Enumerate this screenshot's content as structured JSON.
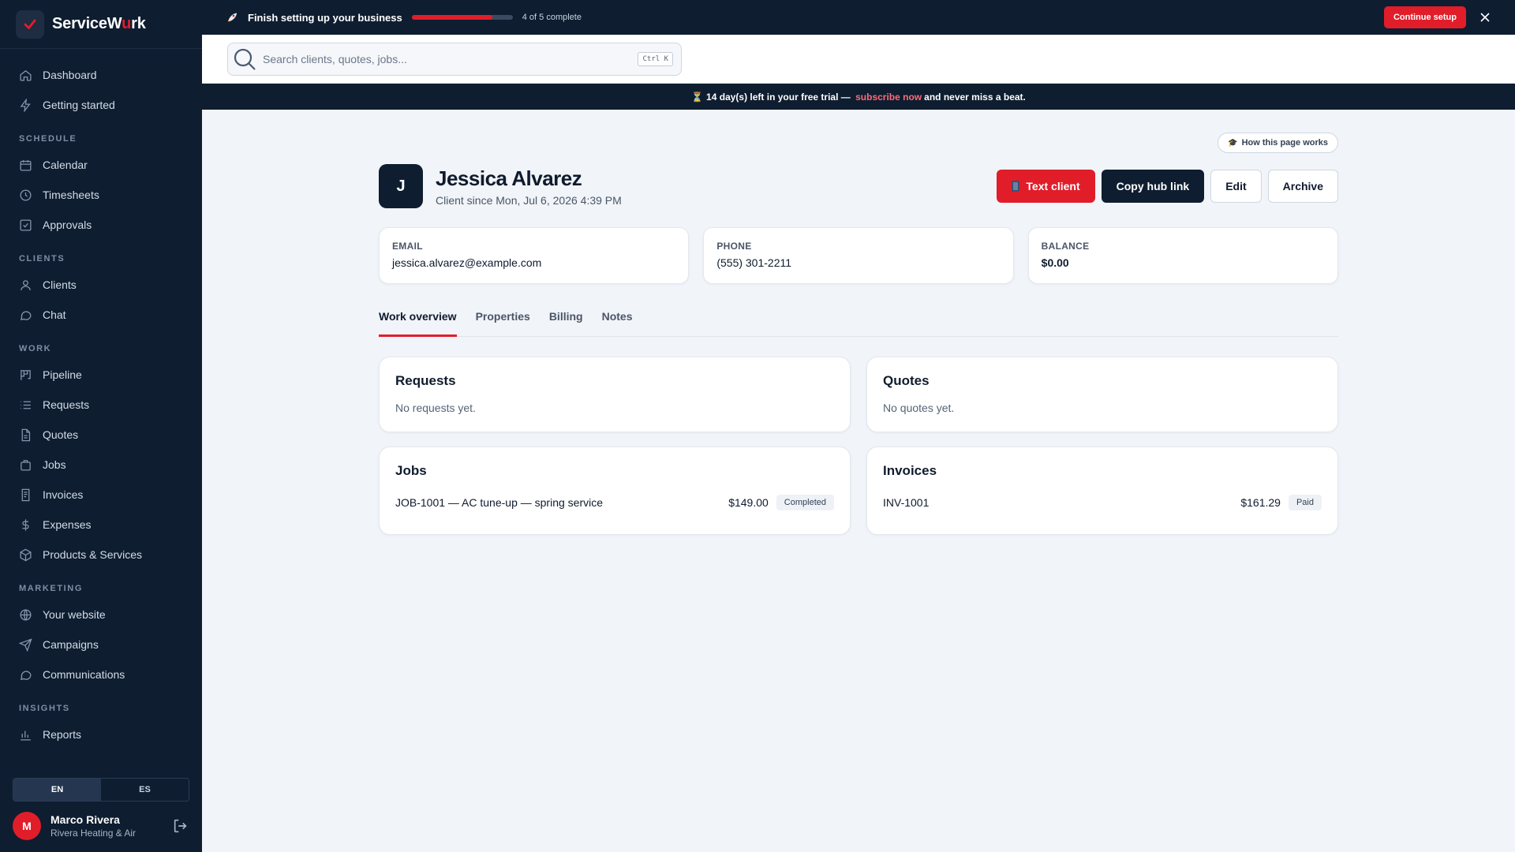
{
  "brand": {
    "name_prefix": "ServiceW",
    "name_accent": "u",
    "name_suffix": "rk"
  },
  "sidebar": {
    "items_top": [
      {
        "label": "Dashboard",
        "icon": "home-icon"
      },
      {
        "label": "Getting started",
        "icon": "bolt-icon"
      }
    ],
    "sections": [
      {
        "title": "SCHEDULE",
        "items": [
          {
            "label": "Calendar",
            "icon": "calendar-icon"
          },
          {
            "label": "Timesheets",
            "icon": "clock-icon"
          },
          {
            "label": "Approvals",
            "icon": "check-square-icon"
          }
        ]
      },
      {
        "title": "CLIENTS",
        "items": [
          {
            "label": "Clients",
            "icon": "user-icon"
          },
          {
            "label": "Chat",
            "icon": "chat-icon"
          }
        ]
      },
      {
        "title": "WORK",
        "items": [
          {
            "label": "Pipeline",
            "icon": "kanban-icon"
          },
          {
            "label": "Requests",
            "icon": "list-icon"
          },
          {
            "label": "Quotes",
            "icon": "document-icon"
          },
          {
            "label": "Jobs",
            "icon": "briefcase-icon"
          },
          {
            "label": "Invoices",
            "icon": "invoice-icon"
          },
          {
            "label": "Expenses",
            "icon": "dollar-icon"
          },
          {
            "label": "Products & Services",
            "icon": "box-icon"
          }
        ]
      },
      {
        "title": "MARKETING",
        "items": [
          {
            "label": "Your website",
            "icon": "globe-icon"
          },
          {
            "label": "Campaigns",
            "icon": "send-icon"
          },
          {
            "label": "Communications",
            "icon": "message-icon"
          }
        ]
      },
      {
        "title": "INSIGHTS",
        "items": [
          {
            "label": "Reports",
            "icon": "bar-chart-icon"
          }
        ]
      }
    ],
    "language": {
      "en": "EN",
      "es": "ES",
      "active": "EN"
    },
    "user": {
      "initial": "M",
      "name": "Marco Rivera",
      "org": "Rivera Heating & Air"
    }
  },
  "setup": {
    "title": "Finish setting up your business",
    "progress_fraction": 0.8,
    "count_text": "4 of 5 complete",
    "continue_label": "Continue setup"
  },
  "search": {
    "placeholder": "Search clients, quotes, jobs...",
    "shortcut": "Ctrl K"
  },
  "trial": {
    "days": "14",
    "text_before": " day(s) left in your free trial — ",
    "link": "subscribe now",
    "text_after": "and never miss a beat."
  },
  "client": {
    "how_label": "How this page works",
    "initial": "J",
    "name": "Jessica Alvarez",
    "since": "Client since Mon, Jul 6, 2026 4:39 PM",
    "actions": {
      "text": "Text client",
      "copy": "Copy hub link",
      "edit": "Edit",
      "archive": "Archive"
    },
    "email_label": "EMAIL",
    "email": "jessica.alvarez@example.com",
    "phone_label": "PHONE",
    "phone": "(555) 301-2211",
    "balance_label": "BALANCE",
    "balance": "$0.00"
  },
  "tabs": [
    "Work overview",
    "Properties",
    "Billing",
    "Notes"
  ],
  "panels": {
    "requests": {
      "title": "Requests",
      "empty": "No requests yet."
    },
    "quotes": {
      "title": "Quotes",
      "empty": "No quotes yet."
    },
    "jobs": {
      "title": "Jobs",
      "row": {
        "name": "JOB-1001 — AC tune-up — spring service",
        "amount": "$149.00",
        "status": "Completed"
      }
    },
    "invoices": {
      "title": "Invoices",
      "row": {
        "name": "INV-1001",
        "amount": "$161.29",
        "status": "Paid"
      }
    }
  }
}
